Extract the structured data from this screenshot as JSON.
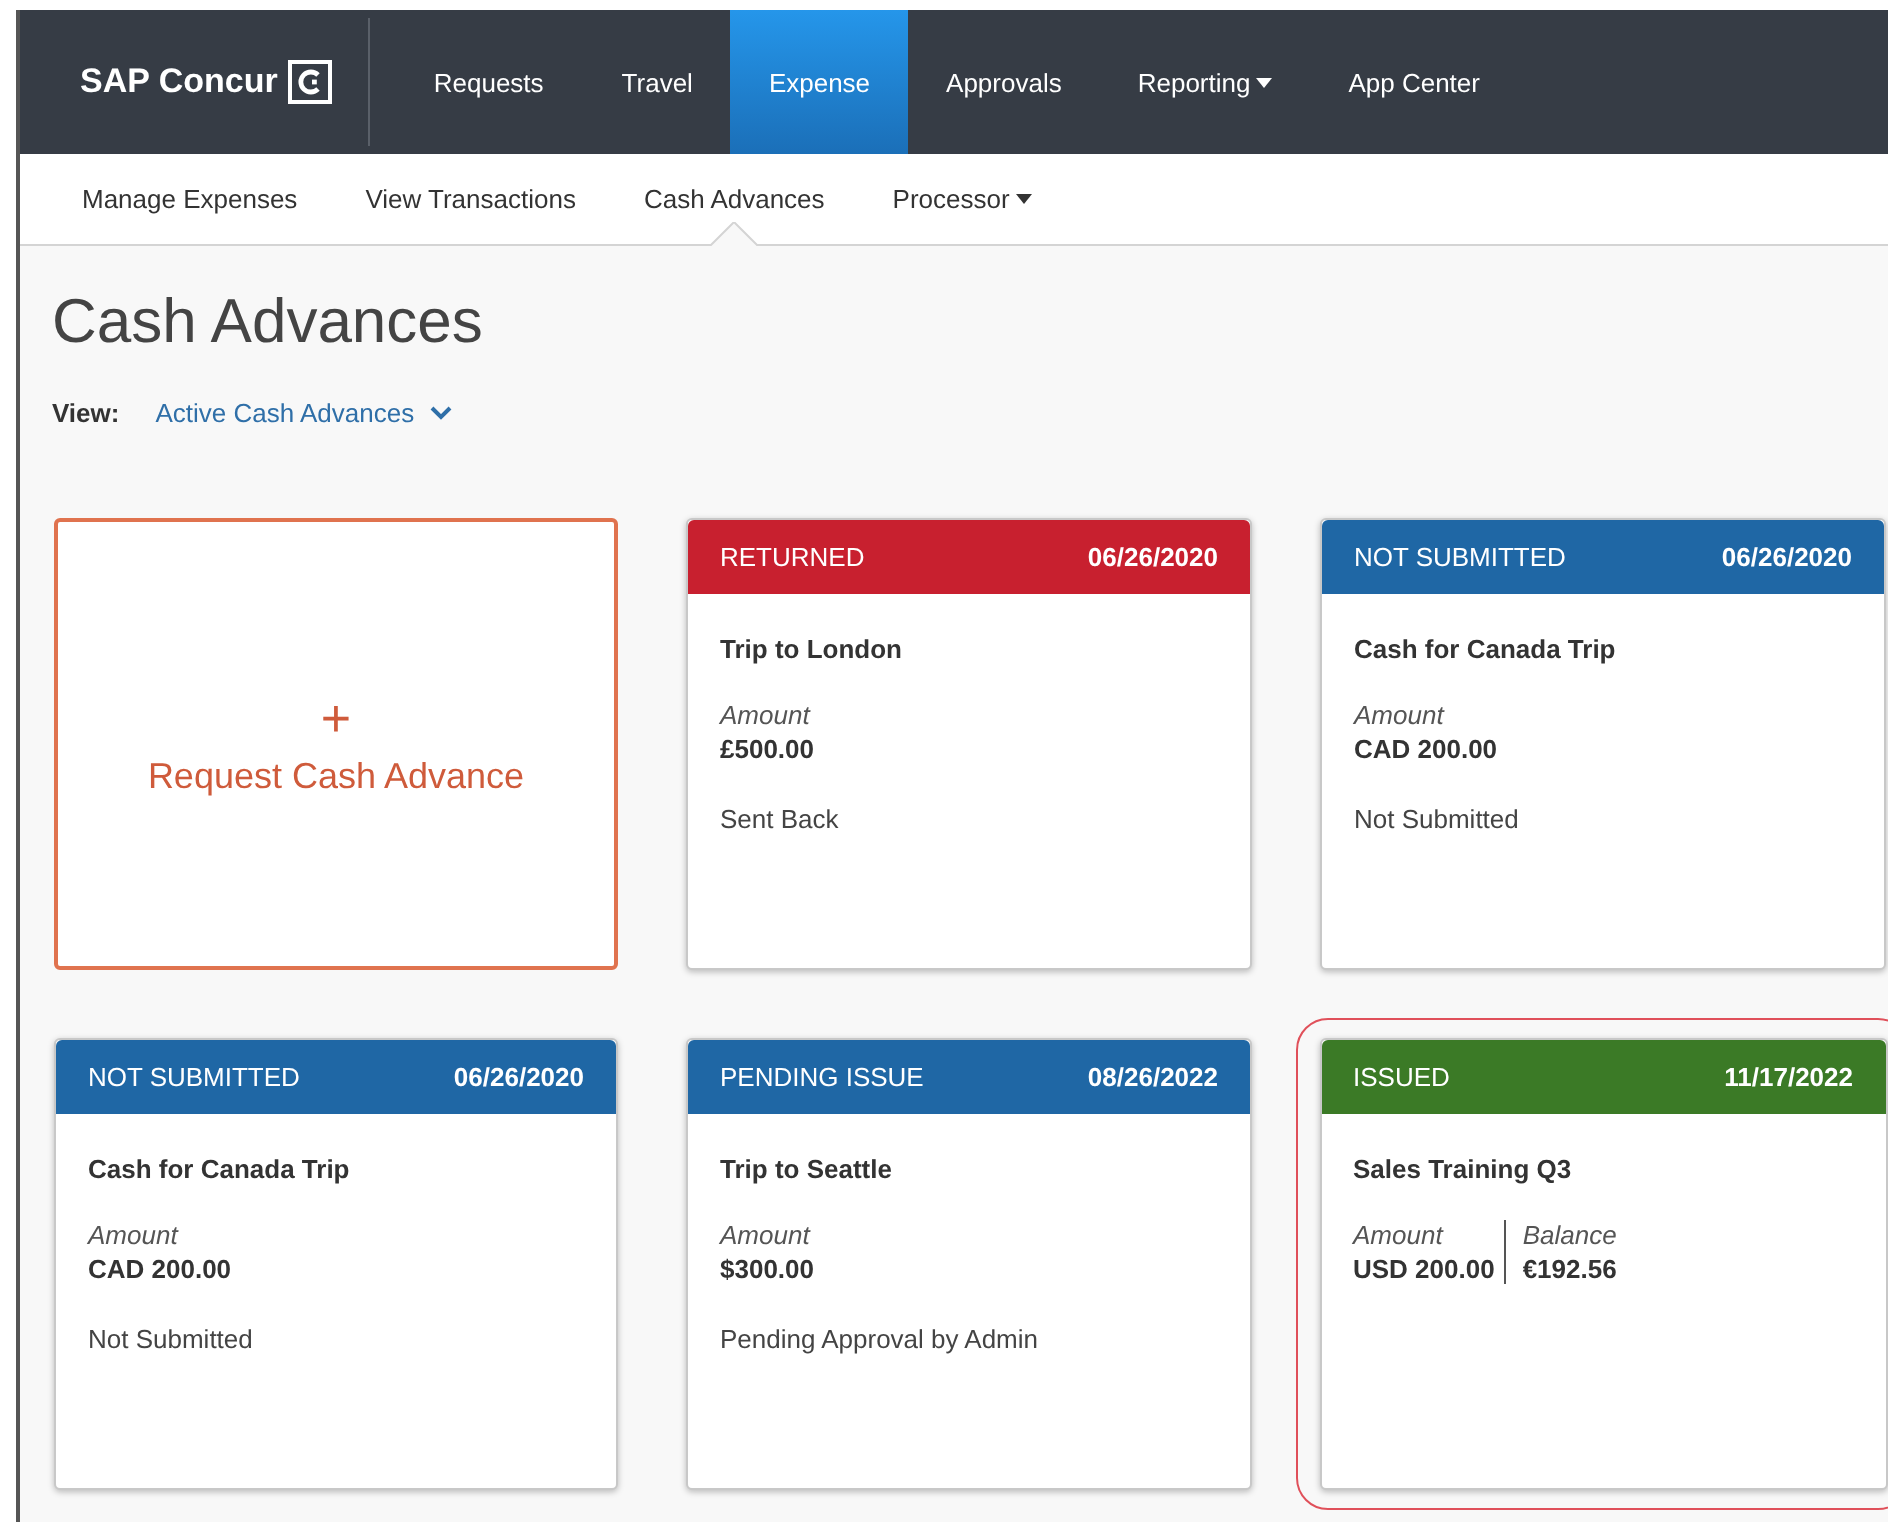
{
  "brand": {
    "name": "SAP Concur"
  },
  "nav": [
    {
      "label": "Requests",
      "selected": false,
      "dropdown": false
    },
    {
      "label": "Travel",
      "selected": false,
      "dropdown": false
    },
    {
      "label": "Expense",
      "selected": true,
      "dropdown": false
    },
    {
      "label": "Approvals",
      "selected": false,
      "dropdown": false
    },
    {
      "label": "Reporting",
      "selected": false,
      "dropdown": true
    },
    {
      "label": "App Center",
      "selected": false,
      "dropdown": false
    }
  ],
  "subnav": [
    {
      "label": "Manage Expenses",
      "selected": false,
      "dropdown": false
    },
    {
      "label": "View Transactions",
      "selected": false,
      "dropdown": false
    },
    {
      "label": "Cash Advances",
      "selected": true,
      "dropdown": false
    },
    {
      "label": "Processor",
      "selected": false,
      "dropdown": true
    }
  ],
  "page_title": "Cash Advances",
  "view": {
    "label": "View:",
    "value": "Active Cash Advances"
  },
  "cards": [
    {
      "kind": "request",
      "plus": "+",
      "label": "Request Cash Advance"
    },
    {
      "kind": "advance",
      "status": "RETURNED",
      "color": "#c8202f",
      "date": "06/26/2020",
      "name": "Trip to London",
      "amounts": [
        {
          "label": "Amount",
          "value": "£500.00"
        }
      ],
      "note": "Sent Back",
      "highlighted": false
    },
    {
      "kind": "advance",
      "status": "NOT SUBMITTED",
      "color": "#1f67a5",
      "date": "06/26/2020",
      "name": "Cash for Canada Trip",
      "amounts": [
        {
          "label": "Amount",
          "value": "CAD 200.00"
        }
      ],
      "note": "Not Submitted",
      "highlighted": false
    },
    {
      "kind": "advance",
      "status": "NOT SUBMITTED",
      "color": "#1f67a5",
      "date": "06/26/2020",
      "name": "Cash for Canada Trip",
      "amounts": [
        {
          "label": "Amount",
          "value": "CAD 200.00"
        }
      ],
      "note": "Not Submitted",
      "highlighted": false
    },
    {
      "kind": "advance",
      "status": "PENDING ISSUE",
      "color": "#1f67a5",
      "date": "08/26/2022",
      "name": "Trip to Seattle",
      "amounts": [
        {
          "label": "Amount",
          "value": "$300.00"
        }
      ],
      "note": "Pending Approval by Admin",
      "highlighted": false
    },
    {
      "kind": "advance",
      "status": "ISSUED",
      "color": "#3b7a26",
      "date": "11/17/2022",
      "name": "Sales Training Q3",
      "amounts": [
        {
          "label": "Amount",
          "value": "USD 200.00"
        },
        {
          "label": "Balance",
          "value": "€192.56"
        }
      ],
      "highlighted": true
    }
  ]
}
